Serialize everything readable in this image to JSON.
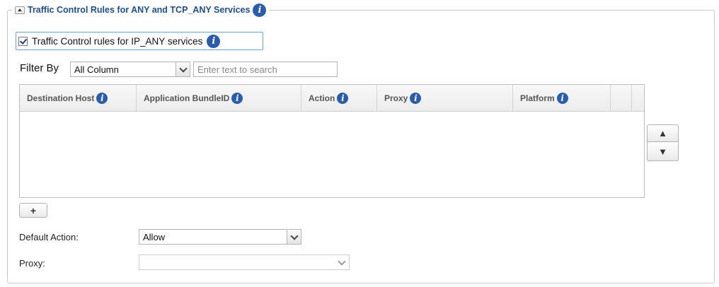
{
  "section": {
    "title": "Traffic Control Rules for ANY and TCP_ANY Services",
    "info_icon": "info-icon"
  },
  "ip_any": {
    "label": "Traffic Control rules for IP_ANY services",
    "checked": true
  },
  "filter": {
    "label": "Filter By",
    "column_value": "All Column",
    "search_placeholder": "Enter text to search"
  },
  "table": {
    "columns": [
      {
        "label": "Destination Host"
      },
      {
        "label": "Application BundleID"
      },
      {
        "label": "Action"
      },
      {
        "label": "Proxy"
      },
      {
        "label": "Platform"
      }
    ],
    "rows": []
  },
  "reorder": {
    "up_label": "▲",
    "down_label": "▼"
  },
  "add_button": {
    "label": "+"
  },
  "default_action": {
    "label": "Default Action:",
    "value": "Allow"
  },
  "proxy": {
    "label": "Proxy:",
    "value": ""
  }
}
